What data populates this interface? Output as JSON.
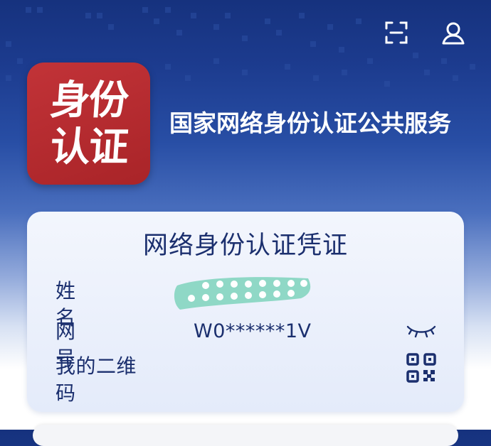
{
  "header": {
    "service_title": "国家网络身份认证公共服务",
    "logo_line1": "身份",
    "logo_line2": "认证",
    "icons": [
      "scan-icon",
      "profile-icon"
    ]
  },
  "credential_card": {
    "title": "网络身份认证凭证",
    "name_label": "姓名",
    "id_label": "网号",
    "id_value": "W0******1V",
    "qr_label": "我的二维码",
    "icons": [
      "eye-closed-icon",
      "qr-code-icon"
    ]
  },
  "colors": {
    "header_blue": "#16327e",
    "logo_red": "#b82b30",
    "card_text": "#1b2f6e",
    "mask_teal": "#8fd8c6"
  }
}
